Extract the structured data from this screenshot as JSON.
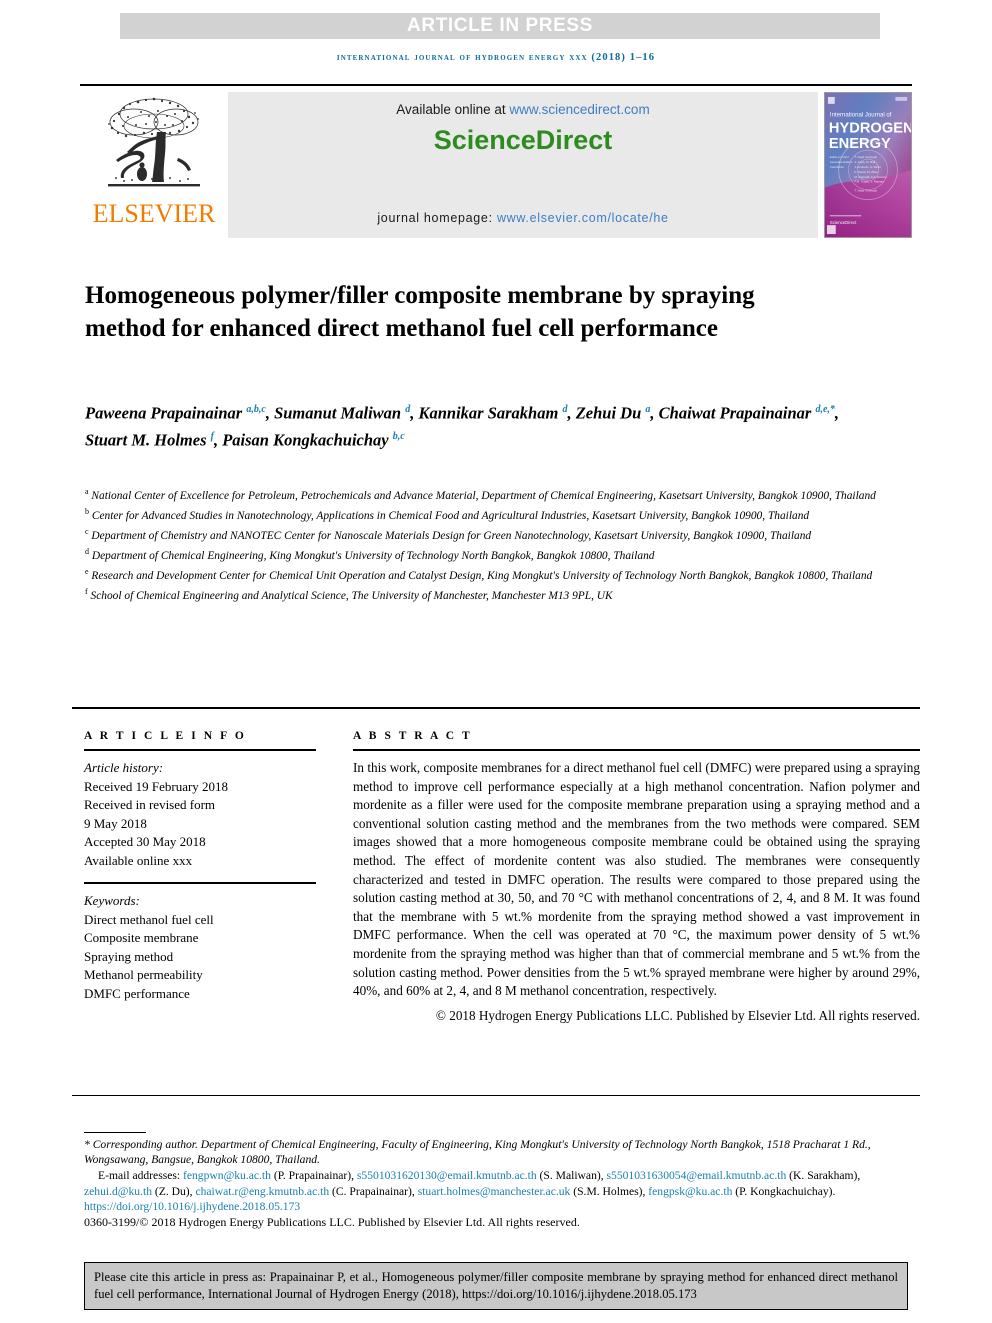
{
  "banner": {
    "article_in_press": "ARTICLE IN PRESS"
  },
  "running_head": "international journal of hydrogen energy xxx (2018) 1–16",
  "masthead": {
    "elsevier_wordmark": "ELSEVIER",
    "available_online_prefix": "Available online at ",
    "sciencedirect_url": "www.sciencedirect.com",
    "sciencedirect_logo_part1": "Science",
    "sciencedirect_logo_part2": "Direct",
    "journal_homepage_label": "journal homepage: ",
    "journal_homepage_url": "www.elsevier.com/locate/he",
    "cover": {
      "line1": "International Journal of",
      "line2": "HYDROGEN",
      "line3": "ENERGY",
      "publisher": "ScienceDirect"
    }
  },
  "title": "Homogeneous polymer/filler composite membrane by spraying method for enhanced direct methanol fuel cell performance",
  "authors_html": "Paweena Prapainainar <sup>a,b,c</sup>, Sumanut Maliwan <sup>d</sup>, Kannikar Sarakham <sup>d</sup>, Zehui Du <sup>a</sup>, Chaiwat Prapainainar <sup>d,e,*</sup>, Stuart M. Holmes <sup>f</sup>, Paisan Kongkachuichay <sup>b,c</sup>",
  "affiliations": [
    {
      "marker": "a",
      "text": "National Center of Excellence for Petroleum, Petrochemicals and Advance Material, Department of Chemical Engineering, Kasetsart University, Bangkok 10900, Thailand"
    },
    {
      "marker": "b",
      "text": "Center for Advanced Studies in Nanotechnology, Applications in Chemical Food and Agricultural Industries, Kasetsart University, Bangkok 10900, Thailand"
    },
    {
      "marker": "c",
      "text": "Department of Chemistry and NANOTEC Center for Nanoscale Materials Design for Green Nanotechnology, Kasetsart University, Bangkok 10900, Thailand"
    },
    {
      "marker": "d",
      "text": "Department of Chemical Engineering, King Mongkut's University of Technology North Bangkok, Bangkok 10800, Thailand"
    },
    {
      "marker": "e",
      "text": "Research and Development Center for Chemical Unit Operation and Catalyst Design, King Mongkut's University of Technology North Bangkok, Bangkok 10800, Thailand"
    },
    {
      "marker": "f",
      "text": "School of Chemical Engineering and Analytical Science, The University of Manchester, Manchester M13 9PL, UK"
    }
  ],
  "article_info": {
    "heading": "A R T I C L E  I N F O",
    "history_label": "Article history:",
    "history": [
      "Received 19 February 2018",
      "Received in revised form",
      "9 May 2018",
      "Accepted 30 May 2018",
      "Available online xxx"
    ],
    "keywords_label": "Keywords:",
    "keywords": [
      "Direct methanol fuel cell",
      "Composite membrane",
      "Spraying method",
      "Methanol permeability",
      "DMFC performance"
    ]
  },
  "abstract": {
    "heading": "A B S T R A C T",
    "body": "In this work, composite membranes for a direct methanol fuel cell (DMFC) were prepared using a spraying method to improve cell performance especially at a high methanol concentration. Nafion polymer and mordenite as a filler were used for the composite membrane preparation using a spraying method and a conventional solution casting method and the membranes from the two methods were compared. SEM images showed that a more homogeneous composite membrane could be obtained using the spraying method. The effect of mordenite content was also studied. The membranes were consequently characterized and tested in DMFC operation. The results were compared to those prepared using the solution casting method at 30, 50, and 70 °C with methanol concentrations of 2, 4, and 8 M. It was found that the membrane with 5 wt.% mordenite from the spraying method showed a vast improvement in DMFC performance. When the cell was operated at 70 °C, the maximum power density of 5 wt.% mordenite from the spraying method was higher than that of commercial membrane and 5 wt.% from the solution casting method. Power densities from the 5 wt.% sprayed membrane were higher by around 29%, 40%, and 60% at 2, 4, and 8 M methanol concentration, respectively.",
    "copyright": "© 2018 Hydrogen Energy Publications LLC. Published by Elsevier Ltd. All rights reserved."
  },
  "footnote": {
    "corresponding": "* Corresponding author. Department of Chemical Engineering, Faculty of Engineering, King Mongkut's University of Technology North Bangkok, 1518 Pracharat 1 Rd., Wongsawang, Bangsue, Bangkok 10800, Thailand.",
    "email_label": "E-mail addresses: ",
    "emails": [
      {
        "address": "fengpwn@ku.ac.th",
        "person": " (P. Prapainainar), "
      },
      {
        "address": "s5501031620130@email.kmutnb.ac.th",
        "person": " (S. Maliwan), "
      },
      {
        "address": "s5501031630054@email.kmutnb.ac.th",
        "person": " (K. Sarakham), "
      },
      {
        "address": "zehui.d@ku.th",
        "person": " (Z. Du), "
      },
      {
        "address": "chaiwat.r@eng.kmutnb.ac.th",
        "person": " (C. Prapainainar), "
      },
      {
        "address": "stuart.holmes@manchester.ac.uk",
        "person": " (S.M. Holmes), "
      },
      {
        "address": "fengpsk@ku.ac.th",
        "person": " (P. Kongkachuichay)."
      }
    ],
    "doi": "https://doi.org/10.1016/j.ijhydene.2018.05.173",
    "issn_line": "0360-3199/© 2018 Hydrogen Energy Publications LLC. Published by Elsevier Ltd. All rights reserved."
  },
  "cite_box": {
    "text": "Please cite this article in press as: Prapainainar P, et al., Homogeneous polymer/filler composite membrane by spraying method for enhanced direct methanol fuel cell performance, International Journal of Hydrogen Energy (2018), https://doi.org/10.1016/j.ijhydene.2018.05.173"
  },
  "colors": {
    "link_blue": "#1a7fb3",
    "sd_green": "#2e8b20",
    "elsevier_orange": "#f07d00",
    "banner_grey": "#d2d2d2",
    "cite_grey": "#c8c8c8"
  }
}
